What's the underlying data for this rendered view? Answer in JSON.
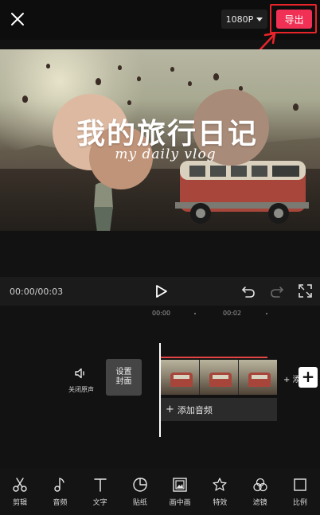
{
  "topbar": {
    "resolution": "1080P",
    "export_label": "导出"
  },
  "preview": {
    "title": "我的旅行日记",
    "subtitle": "my daily vlog"
  },
  "player": {
    "time": "00:00/00:03"
  },
  "timeline": {
    "ruler": [
      "00:00",
      "00:02"
    ],
    "mute_label": "关闭原声",
    "cover_label": "设置\n封面",
    "add_clip_text": "+ 添",
    "add_clip_button": "+",
    "audio_label": "添加音频",
    "audio_plus": "+"
  },
  "toolbar": {
    "items": [
      {
        "label": "剪辑",
        "icon": "scissors-icon"
      },
      {
        "label": "音频",
        "icon": "music-note-icon"
      },
      {
        "label": "文字",
        "icon": "text-icon"
      },
      {
        "label": "贴纸",
        "icon": "sticker-icon"
      },
      {
        "label": "画中画",
        "icon": "picture-in-picture-icon"
      },
      {
        "label": "特效",
        "icon": "effects-star-icon"
      },
      {
        "label": "滤镜",
        "icon": "filter-icon"
      },
      {
        "label": "比例",
        "icon": "ratio-icon"
      }
    ]
  },
  "colors": {
    "export": "#f03054",
    "highlight": "#e8242a",
    "background": "#121212"
  }
}
